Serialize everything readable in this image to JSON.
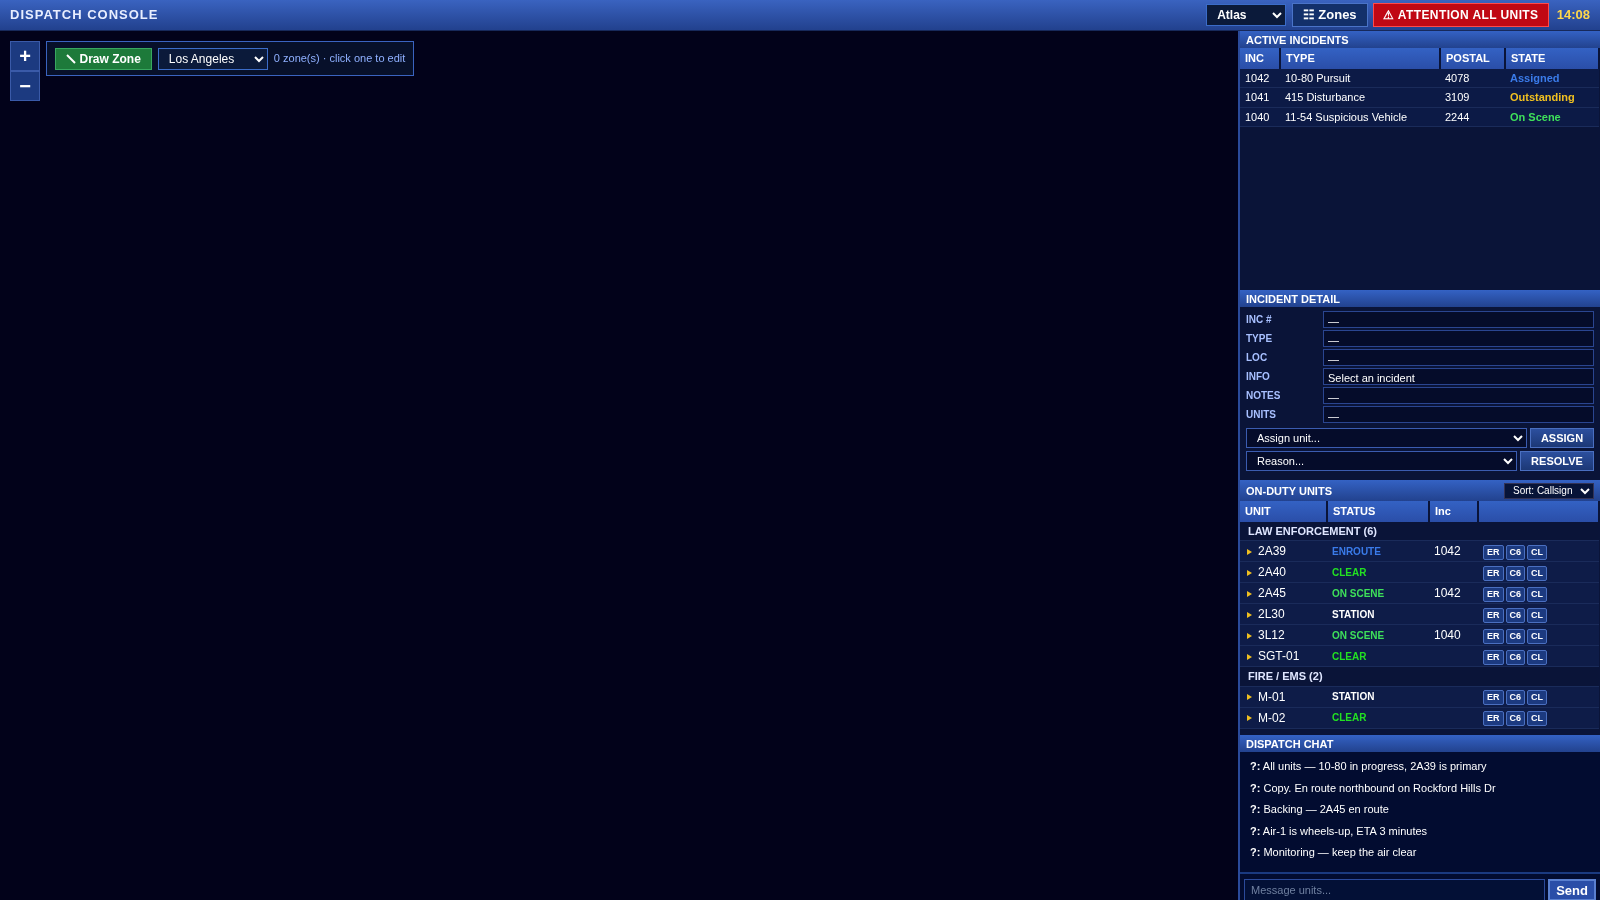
{
  "topbar": {
    "title": "DISPATCH CONSOLE",
    "map_style": "Atlas",
    "zones_button": "☷ Zones",
    "attention_button": "⚠ ATTENTION ALL UNITS",
    "clock": "14:08"
  },
  "map_tools": {
    "zoom_in": "+",
    "zoom_out": "−",
    "draw_button": "Draw Zone",
    "region": "Los Angeles",
    "zone_hint": "0 zone(s) · click one to edit"
  },
  "active_incidents": {
    "title": "ACTIVE INCIDENTS",
    "columns": [
      "INC",
      "TYPE",
      "POSTAL",
      "STATE"
    ],
    "rows": [
      {
        "inc": "1042",
        "type": "10-80 Pursuit",
        "postal": "4078",
        "state": "Assigned",
        "color": "#3a7bea"
      },
      {
        "inc": "1041",
        "type": "415 Disturbance",
        "postal": "3109",
        "state": "Outstanding",
        "color": "#f0c020"
      },
      {
        "inc": "1040",
        "type": "11-54 Suspicious Vehicle",
        "postal": "2244",
        "state": "On Scene",
        "color": "#3ee05a"
      }
    ]
  },
  "incident_detail": {
    "title": "INCIDENT DETAIL",
    "fields": [
      {
        "label": "INC #",
        "value": "—"
      },
      {
        "label": "TYPE",
        "value": "—"
      },
      {
        "label": "LOC",
        "value": "—"
      },
      {
        "label": "INFO",
        "value": "Select an incident"
      },
      {
        "label": "NOTES",
        "value": "—"
      },
      {
        "label": "UNITS",
        "value": "—"
      }
    ],
    "assign_select": "Assign unit...",
    "assign_button": "ASSIGN",
    "reason_select": "Reason...",
    "resolve_button": "RESOLVE"
  },
  "units": {
    "title": "ON-DUTY UNITS",
    "sort": "Sort: Callsign",
    "columns": [
      "UNIT",
      "STATUS",
      "Inc"
    ],
    "groups": [
      {
        "name": "LAW ENFORCEMENT (6)",
        "units": [
          {
            "unit": "2A39",
            "status": "ENROUTE",
            "color": "#3a7bea",
            "inc": "1042",
            "actions": [
              "ER",
              "C6",
              "CL"
            ]
          },
          {
            "unit": "2A40",
            "status": "CLEAR",
            "color": "#22e022",
            "actions": [
              "ER",
              "C6",
              "CL"
            ]
          },
          {
            "unit": "2A45",
            "status": "ON SCENE",
            "color": "#3ee05a",
            "inc": "1042",
            "actions": [
              "ER",
              "C6",
              "CL"
            ]
          },
          {
            "unit": "2L30",
            "status": "STATION",
            "color": "#ffffff",
            "actions": [
              "ER",
              "C6",
              "CL"
            ]
          },
          {
            "unit": "3L12",
            "status": "ON SCENE",
            "color": "#3ee05a",
            "inc": "1040",
            "actions": [
              "ER",
              "C6",
              "CL"
            ]
          },
          {
            "unit": "SGT-01",
            "status": "CLEAR",
            "color": "#22e022",
            "actions": [
              "ER",
              "C6",
              "CL"
            ]
          }
        ]
      },
      {
        "name": "FIRE / EMS (2)",
        "units": [
          {
            "unit": "M-01",
            "status": "STATION",
            "color": "#ffffff",
            "actions": [
              "ER",
              "C6",
              "CL"
            ]
          },
          {
            "unit": "M-02",
            "status": "CLEAR",
            "color": "#22e022",
            "actions": [
              "ER",
              "C6",
              "CL"
            ]
          }
        ]
      }
    ]
  },
  "chat": {
    "title": "DISPATCH CHAT",
    "messages": [
      "**?:** All units — 10-80 in progress, 2A39 is primary",
      "**?:** Copy. En route northbound on Rockford Hills Dr",
      "**?:** Backing — 2A45 en route",
      "**?:** Air-1 is wheels-up, ETA 3 minutes",
      "**?:** Monitoring — keep the air clear"
    ],
    "input_placeholder": "Message units...",
    "send_button": "Send"
  }
}
